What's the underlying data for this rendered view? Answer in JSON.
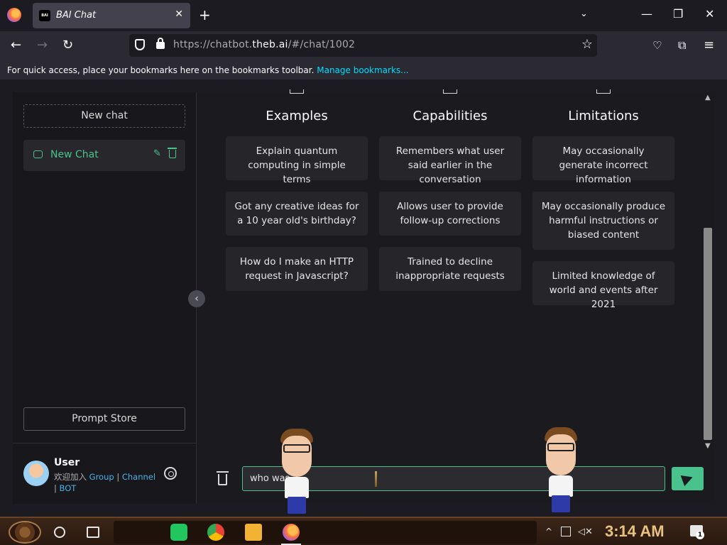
{
  "browser": {
    "tab_title": "BAI Chat",
    "tab_favicon_text": "BAI",
    "url_prefix": "https://chatbot.",
    "url_domain": "theb.ai",
    "url_path": "/#/chat/1002",
    "bookmarks_message": "For quick access, place your bookmarks here on the bookmarks toolbar.",
    "manage_bookmarks": "Manage bookmarks..."
  },
  "sidebar": {
    "new_chat_button": "New chat",
    "chats": [
      {
        "label": "New Chat"
      }
    ],
    "prompt_store_button": "Prompt Store",
    "user": {
      "name": "User",
      "join_prefix": "欢迎加入",
      "group_link": "Group",
      "channel_link": "Channel",
      "bot_link": "BOT"
    }
  },
  "main": {
    "columns": [
      {
        "heading": "Examples",
        "cards": [
          "Explain quantum computing in simple terms",
          "Got any creative ideas for a 10 year old's birthday?",
          "How do I make an HTTP request in Javascript?"
        ]
      },
      {
        "heading": "Capabilities",
        "cards": [
          "Remembers what user said earlier in the conversation",
          "Allows user to provide follow-up corrections",
          "Trained to decline inappropriate requests"
        ]
      },
      {
        "heading": "Limitations",
        "cards": [
          "May occasionally generate incorrect information",
          "May occasionally produce harmful instructions or biased content",
          "Limited knowledge of world and events after 2021"
        ]
      }
    ],
    "input_value": "who was"
  },
  "taskbar": {
    "clock": "3:14 AM",
    "notification_count": "1"
  },
  "colors": {
    "accent": "#4ac28e",
    "background": "#1b1b1f",
    "card": "#25252a",
    "clock": "#e8c27e"
  }
}
